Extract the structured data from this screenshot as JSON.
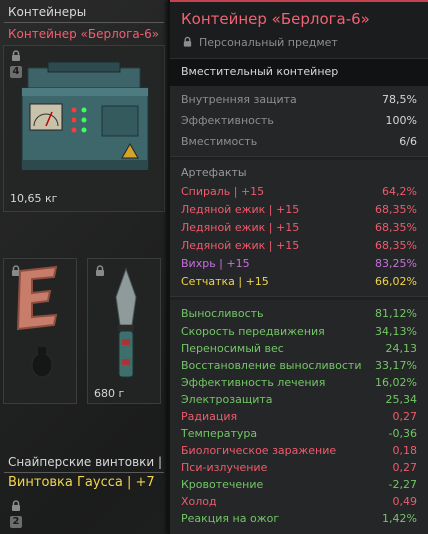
{
  "left": {
    "category": "Контейнеры",
    "container_name": "Контейнер «Берлога-6»",
    "container_badge": "4",
    "container_weight": "10,65 кг",
    "knife_weight": "680 г",
    "sniper_category": "Снайперские винтовки |",
    "sniper_name": "Винтовка Гаусса | +7",
    "sniper_badge": "2"
  },
  "tooltip": {
    "title": "Контейнер «Берлога-6»",
    "subtitle": "Персональный предмет",
    "type": "Вместительный контейнер",
    "base_stats": [
      {
        "label": "Внутренняя защита",
        "value": "78,5%"
      },
      {
        "label": "Эффективность",
        "value": "100%"
      },
      {
        "label": "Вместимость",
        "value": "6/6"
      }
    ],
    "artifacts_header": "Артефакты",
    "artifacts": [
      {
        "label": "Спираль | +15",
        "value": "64,2%",
        "color": "#ef5b6c"
      },
      {
        "label": "Ледяной ежик | +15",
        "value": "68,35%",
        "color": "#ef5b6c"
      },
      {
        "label": "Ледяной ежик | +15",
        "value": "68,35%",
        "color": "#ef5b6c"
      },
      {
        "label": "Ледяной ежик | +15",
        "value": "68,35%",
        "color": "#ef5b6c"
      },
      {
        "label": "Вихрь | +15",
        "value": "83,25%",
        "color": "#c96ee0"
      },
      {
        "label": "Сетчатка | +15",
        "value": "66,02%",
        "color": "#f0d548"
      }
    ],
    "effects": [
      {
        "label": "Выносливость",
        "value": "81,12%",
        "color": "#73c766"
      },
      {
        "label": "Скорость передвижения",
        "value": "34,13%",
        "color": "#73c766"
      },
      {
        "label": "Переносимый вес",
        "value": "24,13",
        "color": "#73c766"
      },
      {
        "label": "Восстановление выносливости",
        "value": "33,17%",
        "color": "#73c766"
      },
      {
        "label": "Эффективность лечения",
        "value": "16,02%",
        "color": "#73c766"
      },
      {
        "label": "Электрозащита",
        "value": "25,34",
        "color": "#73c766"
      },
      {
        "label": "Радиация",
        "value": "0,27",
        "color": "#ef5b6c"
      },
      {
        "label": "Температура",
        "value": "-0,36",
        "color": "#73c766"
      },
      {
        "label": "Биологическое заражение",
        "value": "0,18",
        "color": "#ef5b6c"
      },
      {
        "label": "Пси-излучение",
        "value": "0,27",
        "color": "#ef5b6c"
      },
      {
        "label": "Кровотечение",
        "value": "-2,27",
        "color": "#73c766"
      },
      {
        "label": "Холод",
        "value": "0,49",
        "color": "#ef5b6c"
      },
      {
        "label": "Реакция на ожог",
        "value": "1,42%",
        "color": "#73c766"
      }
    ]
  }
}
